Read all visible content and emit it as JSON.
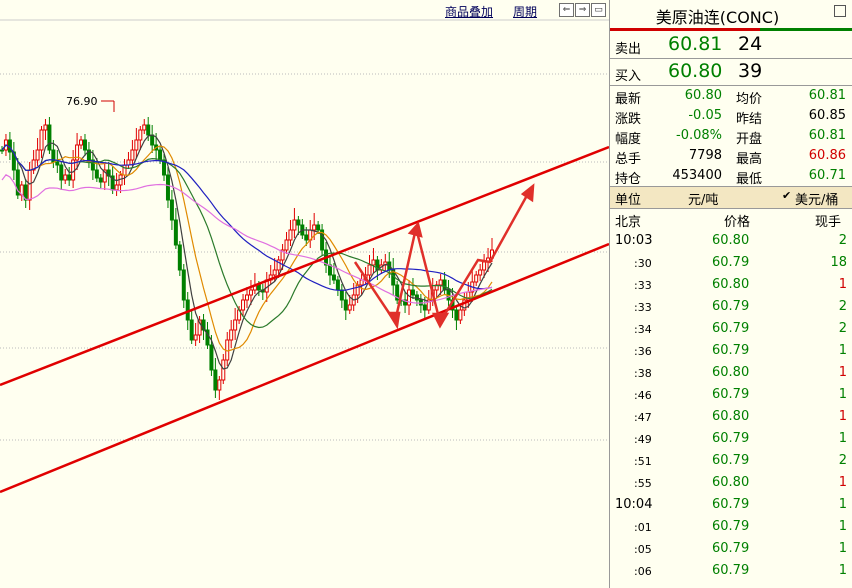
{
  "toolbar": {
    "overlay_label": "商品叠加",
    "period_label": "周期",
    "nav_buttons": [
      "⇐",
      "⇒",
      "▭"
    ]
  },
  "chart": {
    "peak_label": "76.90"
  },
  "quote": {
    "title": "美原油连(CONC)",
    "sell_label": "卖出",
    "sell_price": "60.81",
    "sell_vol": "24",
    "buy_label": "买入",
    "buy_price": "60.80",
    "buy_vol": "39",
    "stats": [
      {
        "l1": "最新",
        "v1": "60.80",
        "c1": "green",
        "l2": "均价",
        "v2": "60.81",
        "c2": "green"
      },
      {
        "l1": "涨跌",
        "v1": "-0.05",
        "c1": "green",
        "l2": "昨结",
        "v2": "60.85",
        "c2": "black"
      },
      {
        "l1": "幅度",
        "v1": "-0.08%",
        "c1": "green",
        "l2": "开盘",
        "v2": "60.81",
        "c2": "green"
      },
      {
        "l1": "总手",
        "v1": "7798",
        "c1": "black",
        "l2": "最高",
        "v2": "60.86",
        "c2": "red"
      },
      {
        "l1": "持仓",
        "v1": "453400",
        "c1": "black",
        "l2": "最低",
        "v2": "60.71",
        "c2": "green"
      }
    ],
    "unit_label": "单位",
    "unit_primary": "元/吨",
    "unit_secondary": "美元/桶",
    "colors": {
      "up": "#d00000",
      "down": "#008000",
      "accent": "#d00000"
    }
  },
  "ticks": {
    "header": [
      "北京",
      "价格",
      "现手"
    ],
    "rows": [
      {
        "time": "10:03",
        "price": "60.80",
        "vol": "2",
        "pc": "green",
        "vc": "green"
      },
      {
        "time": ":30",
        "price": "60.79",
        "vol": "18",
        "pc": "green",
        "vc": "green"
      },
      {
        "time": ":33",
        "price": "60.80",
        "vol": "1",
        "pc": "green",
        "vc": "red"
      },
      {
        "time": ":33",
        "price": "60.79",
        "vol": "2",
        "pc": "green",
        "vc": "green"
      },
      {
        "time": ":34",
        "price": "60.79",
        "vol": "2",
        "pc": "green",
        "vc": "green"
      },
      {
        "time": ":36",
        "price": "60.79",
        "vol": "1",
        "pc": "green",
        "vc": "green"
      },
      {
        "time": ":38",
        "price": "60.80",
        "vol": "1",
        "pc": "green",
        "vc": "red"
      },
      {
        "time": ":46",
        "price": "60.79",
        "vol": "1",
        "pc": "green",
        "vc": "green"
      },
      {
        "time": ":47",
        "price": "60.80",
        "vol": "1",
        "pc": "green",
        "vc": "red"
      },
      {
        "time": ":49",
        "price": "60.79",
        "vol": "1",
        "pc": "green",
        "vc": "green"
      },
      {
        "time": ":51",
        "price": "60.79",
        "vol": "2",
        "pc": "green",
        "vc": "green"
      },
      {
        "time": ":55",
        "price": "60.80",
        "vol": "1",
        "pc": "green",
        "vc": "red"
      },
      {
        "time": "10:04",
        "price": "60.79",
        "vol": "1",
        "pc": "green",
        "vc": "green"
      },
      {
        "time": ":01",
        "price": "60.79",
        "vol": "1",
        "pc": "green",
        "vc": "green"
      },
      {
        "time": ":05",
        "price": "60.79",
        "vol": "1",
        "pc": "green",
        "vc": "green"
      },
      {
        "time": ":06",
        "price": "60.79",
        "vol": "1",
        "pc": "green",
        "vc": "green"
      }
    ]
  }
}
